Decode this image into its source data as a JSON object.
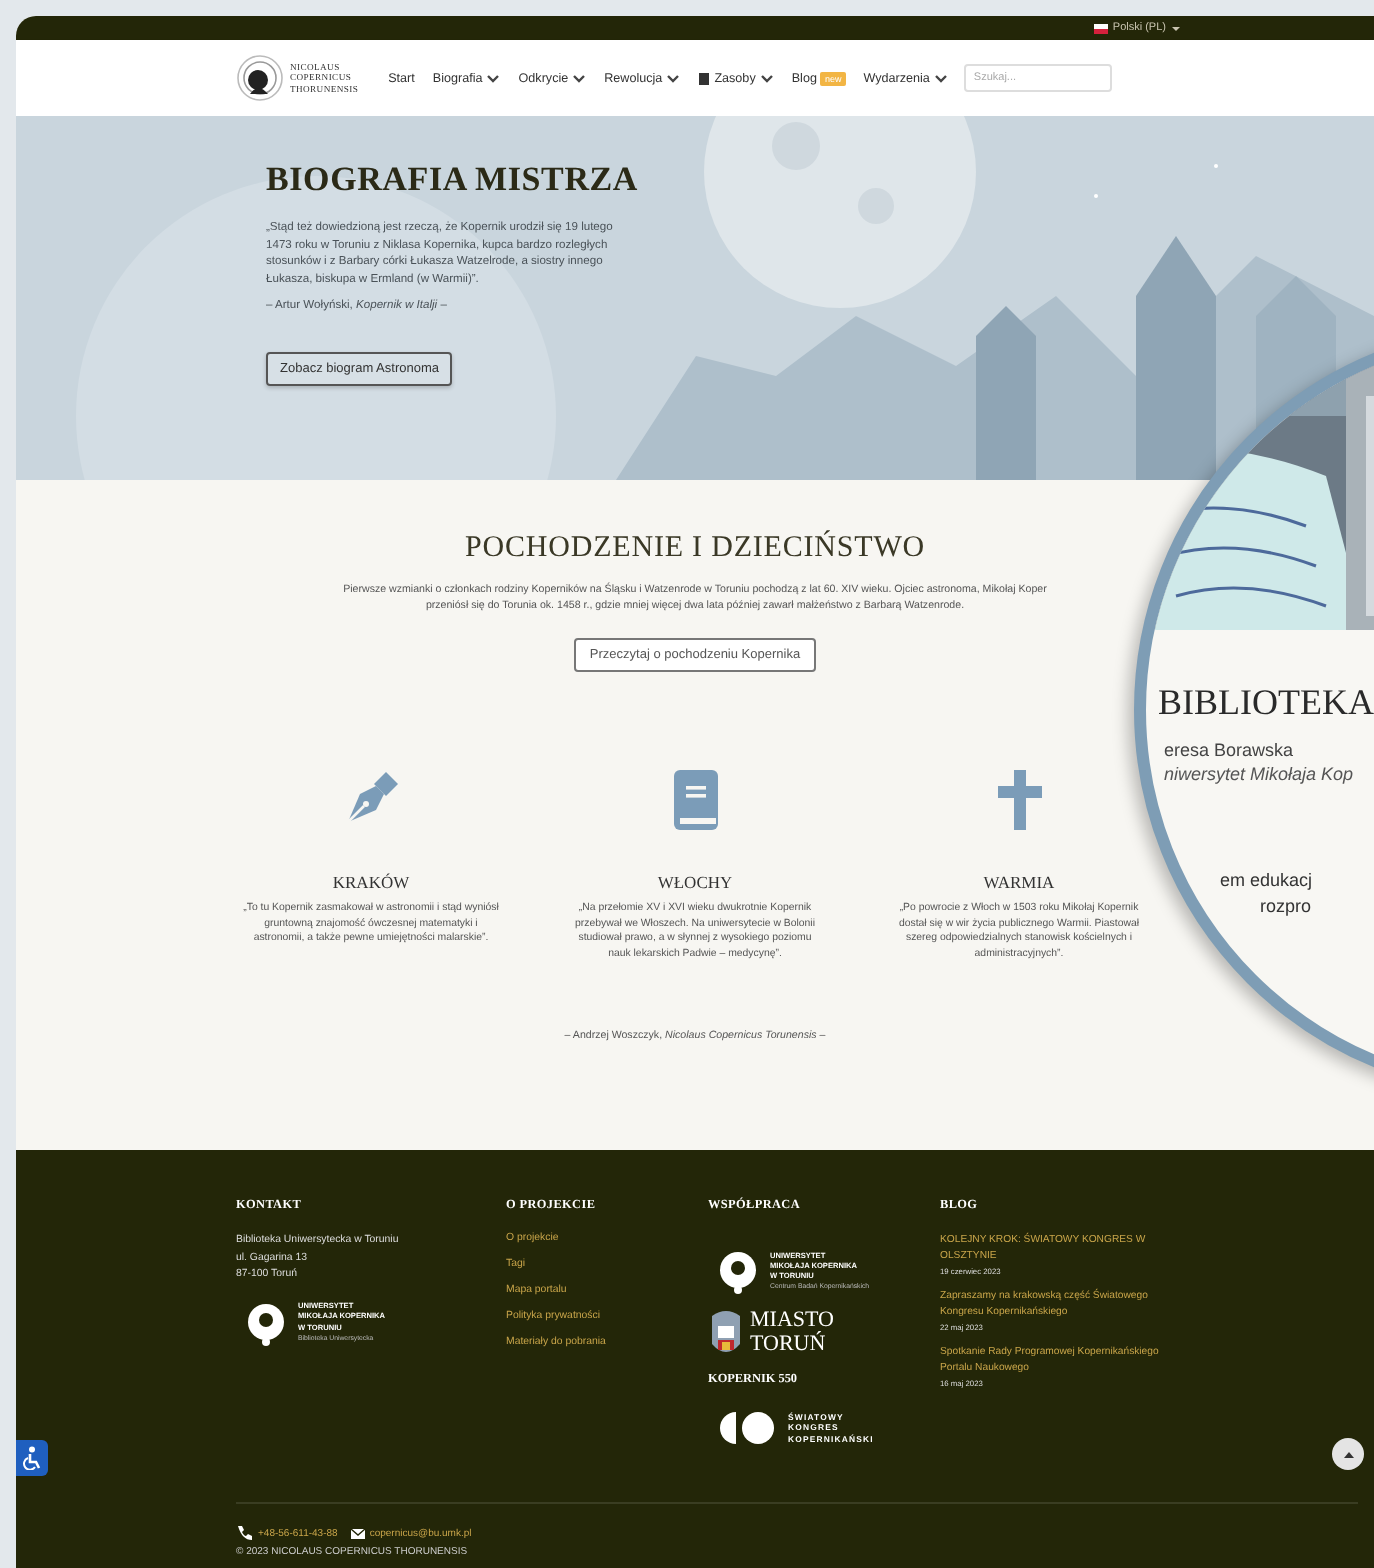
{
  "top_bar": {
    "language": "Polski (PL)"
  },
  "logo": {
    "lines": [
      "NICOLAUS",
      "COPERNICUS",
      "THORUNENSIS"
    ]
  },
  "nav": [
    {
      "label": "Start",
      "dropdown": false,
      "icon": false
    },
    {
      "label": "Biografia",
      "dropdown": true,
      "icon": false
    },
    {
      "label": "Odkrycie",
      "dropdown": true,
      "icon": false
    },
    {
      "label": "Rewolucja",
      "dropdown": true,
      "icon": false
    },
    {
      "label": "Zasoby",
      "dropdown": true,
      "icon": true
    },
    {
      "label": "Blog",
      "dropdown": false,
      "icon": false,
      "badge": "new"
    },
    {
      "label": "Wydarzenia",
      "dropdown": true,
      "icon": false
    }
  ],
  "search": {
    "placeholder": "Szukaj..."
  },
  "hero": {
    "kind": "picture",
    "title": "BIOGRAFIA MISTRZA",
    "quote": "„Stąd też dowiedzioną jest rzeczą, że Kopernik urodził się 19 lutego 1473 roku w Toruniu z Niklasa Kopernika, kupca bardzo rozległych stosunków i z Barbary córki Łukasza Watzelrode, a siostry innego Łukasza, biskupa w Ermland (w Warmii)”.",
    "attribution": "– Artur Wołyński, *Kopernik w Italji* –",
    "button": "Zobacz biogram Astronoma"
  },
  "origin": {
    "title": "POCHODZENIE I DZIECIŃSTWO",
    "paragraph_lines": [
      "Pierwsze wzmianki o członkach rodziny Koperników na Śląsku i Watzenrode w Toruniu pochodzą z lat 60. XIV wieku. Ojciec astronoma, Mikołaj Koper",
      "przeniósł się do Torunia ok. 1458 r., gdzie mniej więcej dwa lata później zawarł małżeństwo z Barbarą Watzenrode."
    ],
    "button": "Przeczytaj o pochodzeniu Kopernika",
    "columns": [
      {
        "title": "KRAKÓW",
        "text": "„To tu Kopernik zasmakował w astronomii i stąd wyniósł gruntowną znajomość ówczesnej matematyki i astronomii, a także pewne umiejętności malarskie”."
      },
      {
        "title": "WŁOCHY",
        "text": "„Na przełomie XV i XVI wieku dwukrotnie Kopernik przebywał we Włoszech. Na uniwersytecie w Bolonii studiował prawo, a w słynnej z wysokiego poziomu nauk lekarskich Padwie – medycynę”."
      },
      {
        "title": "WARMIA",
        "text": "„Po powrocie z Włoch w 1503 roku Mikołaj Kopernik dostał się w wir życia publicznego Warmii. Piastował szereg odpowiedzialnych stanowisk kościelnych i administracyjnych”."
      }
    ],
    "attribution": "– Andrzej Woszczyk, *Nicolaus Copernicus Torunensis* –"
  },
  "lens": {
    "kind": "picture",
    "title": "BIBLIOTEKA",
    "author": "eresa Borawska",
    "affiliation": "niwersytet Mikołaja Kop",
    "text_lines": [
      "em edukacj",
      "rozpro"
    ]
  },
  "footer": {
    "columns": [
      {
        "title": "KONTAKT",
        "items": [
          {
            "kind": "text",
            "lines": [
              "Biblioteka Uniwersytecka w Toruniu",
              "ul. Gagarina 13",
              "87-100 Toruń"
            ]
          },
          {
            "kind": "university_logo",
            "lines": [
              "UNIWERSYTET",
              "MIKOŁAJA KOPERNIKA",
              "W TORUNIU"
            ],
            "subtitle": "Biblioteka Uniwersytecka"
          }
        ]
      },
      {
        "title": "O PROJEKCIE",
        "items": [
          {
            "kind": "link",
            "text": "O projekcie"
          },
          {
            "kind": "link",
            "text": "Tagi"
          },
          {
            "kind": "link",
            "text": "Mapa portalu"
          },
          {
            "kind": "link",
            "text": "Polityka prywatności"
          },
          {
            "kind": "link",
            "text": "Materiały do pobrania"
          }
        ]
      },
      {
        "title": "WSPÓŁPRACA",
        "items": [
          {
            "kind": "university_logo",
            "lines": [
              "UNIWERSYTET",
              "MIKOŁAJA KOPERNIKA",
              "W TORUNIU"
            ],
            "subtitle": "Centrum Badań Kopernikańskich"
          },
          {
            "kind": "city_logo",
            "lines": [
              "MIASTO",
              "TORUŃ"
            ]
          },
          {
            "kind": "heading",
            "text": "KOPERNIK 550"
          },
          {
            "kind": "congress_logo",
            "lines": [
              "ŚWIATOWY",
              "KONGRES",
              "KOPERNIKAŃSKI"
            ]
          }
        ]
      },
      {
        "title": "BLOG",
        "items": [
          {
            "kind": "post",
            "title": "KOLEJNY KROK: ŚWIATOWY KONGRES W OLSZTYNIE",
            "date": "19 czerwiec 2023"
          },
          {
            "kind": "post",
            "title": "Zapraszamy na krakowską część Światowego Kongresu Kopernikańskiego",
            "date": "22 maj 2023"
          },
          {
            "kind": "post",
            "title": "Spotkanie Rady Programowej Kopernikańskiego Portalu Naukowego",
            "date": "16 maj 2023"
          }
        ]
      }
    ],
    "phone": "+48-56-611-43-88",
    "email": "copernicus@bu.umk.pl",
    "copyright": "© 2023 NICOLAUS COPERNICUS THORUNENSIS"
  }
}
